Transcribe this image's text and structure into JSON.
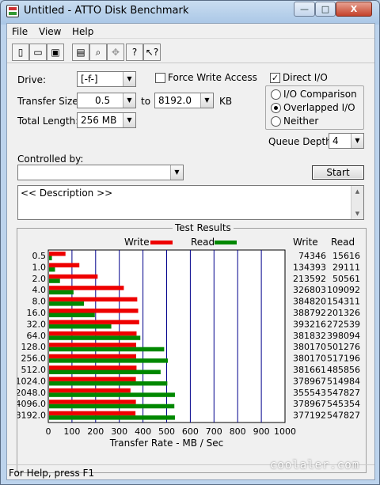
{
  "window": {
    "title": "Untitled - ATTO Disk Benchmark",
    "minimize": "—",
    "maximize": "□",
    "close": "X"
  },
  "menu": [
    "File",
    "View",
    "Help"
  ],
  "toolbar": [
    {
      "name": "new-icon",
      "glyph": "▯"
    },
    {
      "name": "open-icon",
      "glyph": "▭"
    },
    {
      "name": "save-icon",
      "glyph": "▣"
    },
    {
      "name": "print-icon",
      "glyph": "▤"
    },
    {
      "name": "print-preview-icon",
      "glyph": "⌕"
    },
    {
      "name": "move-icon",
      "glyph": "✥"
    },
    {
      "name": "help-icon",
      "glyph": "?"
    },
    {
      "name": "context-help-icon",
      "glyph": "↖?"
    }
  ],
  "settings": {
    "drive_label": "Drive:",
    "drive_value": "[-f-]",
    "force_write_label": "Force Write Access",
    "direct_io_label": "Direct I/O",
    "transfer_size_label": "Transfer Size:",
    "transfer_from": "0.5",
    "transfer_to_word": "to",
    "transfer_to": "8192.0",
    "transfer_unit": "KB",
    "total_length_label": "Total Length:",
    "total_length_value": "256 MB",
    "io_comparison_label": "I/O Comparison",
    "overlapped_io_label": "Overlapped I/O",
    "neither_label": "Neither",
    "queue_depth_label": "Queue Depth:",
    "queue_depth_value": "4",
    "controlled_by_label": "Controlled by:",
    "controlled_by_value": "",
    "start_label": "Start",
    "description": "<< Description >>"
  },
  "results": {
    "title": "Test Results",
    "write_legend": "Write",
    "read_legend": "Read",
    "write_color": "#ee0000",
    "read_color": "#008800",
    "col_write": "Write",
    "col_read": "Read"
  },
  "chart_data": {
    "type": "bar",
    "categories": [
      "0.5",
      "1.0",
      "2.0",
      "4.0",
      "8.0",
      "16.0",
      "32.0",
      "64.0",
      "128.0",
      "256.0",
      "512.0",
      "1024.0",
      "2048.0",
      "4096.0",
      "8192.0"
    ],
    "series": [
      {
        "name": "Write",
        "values": [
          74346,
          134393,
          213592,
          326803,
          384820,
          388792,
          393216,
          381832,
          380170,
          380170,
          381661,
          378967,
          355543,
          378967,
          377192
        ]
      },
      {
        "name": "Read",
        "values": [
          15616,
          29111,
          50561,
          109092,
          154311,
          201326,
          272539,
          398094,
          501276,
          517196,
          485856,
          514984,
          547827,
          545354,
          547827
        ]
      }
    ],
    "write_text": [
      "74346",
      "134393",
      "213592",
      "326803",
      "384820",
      "388792",
      "393216",
      "381832",
      "380170",
      "380170",
      "381661",
      "378967",
      "355543",
      "378967",
      "377192"
    ],
    "read_text": [
      "15616",
      "29111",
      "50561",
      "109092",
      "154311",
      "201326",
      "272539",
      "398094",
      "501276",
      "517196",
      "485856",
      "514984",
      "547827",
      "545354",
      "547827"
    ],
    "x_ticks": [
      "0",
      "100",
      "200",
      "300",
      "400",
      "500",
      "600",
      "700",
      "800",
      "900",
      "1000"
    ],
    "xlabel": "Transfer Rate - MB / Sec",
    "xlim": [
      0,
      1000
    ],
    "grid": true
  },
  "status": {
    "text": "For Help, press F1"
  },
  "watermark": "coolaler.com"
}
